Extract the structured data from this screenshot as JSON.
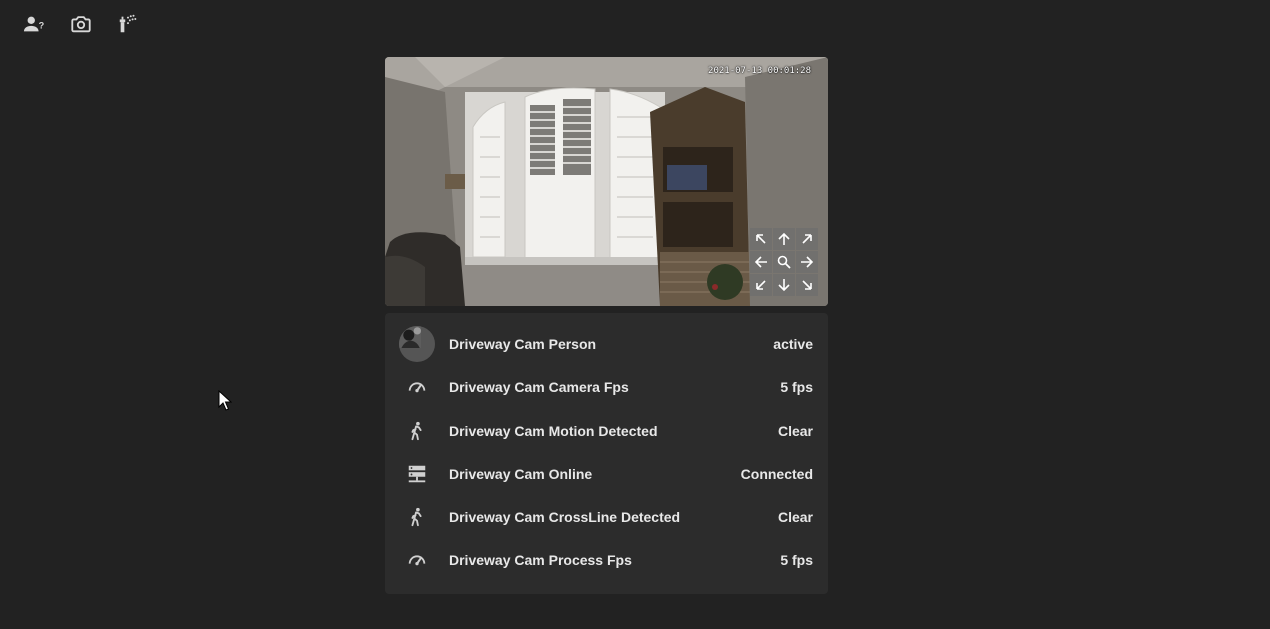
{
  "topbar": {
    "icons": [
      {
        "name": "account-question-icon"
      },
      {
        "name": "camera-icon"
      },
      {
        "name": "sprinkler-icon"
      }
    ]
  },
  "camera": {
    "timestamp": "2021-07-13 00:01:28",
    "ptz": [
      "arrow-top-left",
      "arrow-up",
      "arrow-top-right",
      "arrow-left",
      "zoom",
      "arrow-right",
      "arrow-bottom-left",
      "arrow-down",
      "arrow-bottom-right"
    ]
  },
  "entities": [
    {
      "name": "Driveway Cam Person",
      "state": "active",
      "icon": "avatar-image"
    },
    {
      "name": "Driveway Cam Camera Fps",
      "state": "5 fps",
      "icon": "speedometer-icon"
    },
    {
      "name": "Driveway Cam Motion Detected",
      "state": "Clear",
      "icon": "walk-icon"
    },
    {
      "name": "Driveway Cam Online",
      "state": "Connected",
      "icon": "server-network-icon"
    },
    {
      "name": "Driveway Cam CrossLine Detected",
      "state": "Clear",
      "icon": "walk-icon"
    },
    {
      "name": "Driveway Cam Process Fps",
      "state": "5 fps",
      "icon": "speedometer-icon"
    }
  ],
  "colors": {
    "background": "#222222",
    "card": "#2c2c2c",
    "text": "#e8e8e8",
    "icon": "#d0d0d0"
  }
}
